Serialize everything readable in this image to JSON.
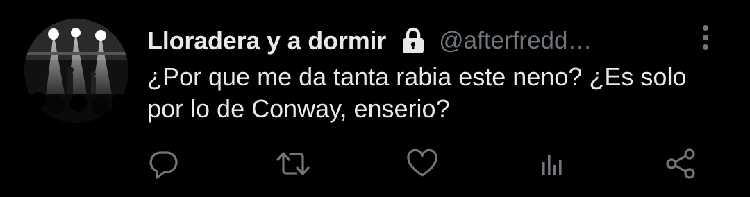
{
  "tweet": {
    "display_name": "Lloradera y a dormir",
    "handle": "@afterfredd…",
    "protected": true,
    "text": "¿Por que me da tanta rabia este neno? ¿Es solo por lo de Conway, enserio?"
  },
  "icons": {
    "avatar": "concert-stage-photo",
    "lock": "lock-icon",
    "more": "more-vertical-icon",
    "reply": "reply-icon",
    "retweet": "retweet-icon",
    "like": "heart-icon",
    "analytics": "analytics-icon",
    "share": "share-icon"
  },
  "colors": {
    "background": "#000000",
    "primary_text": "#e7e9ea",
    "secondary_text": "#71767b"
  }
}
